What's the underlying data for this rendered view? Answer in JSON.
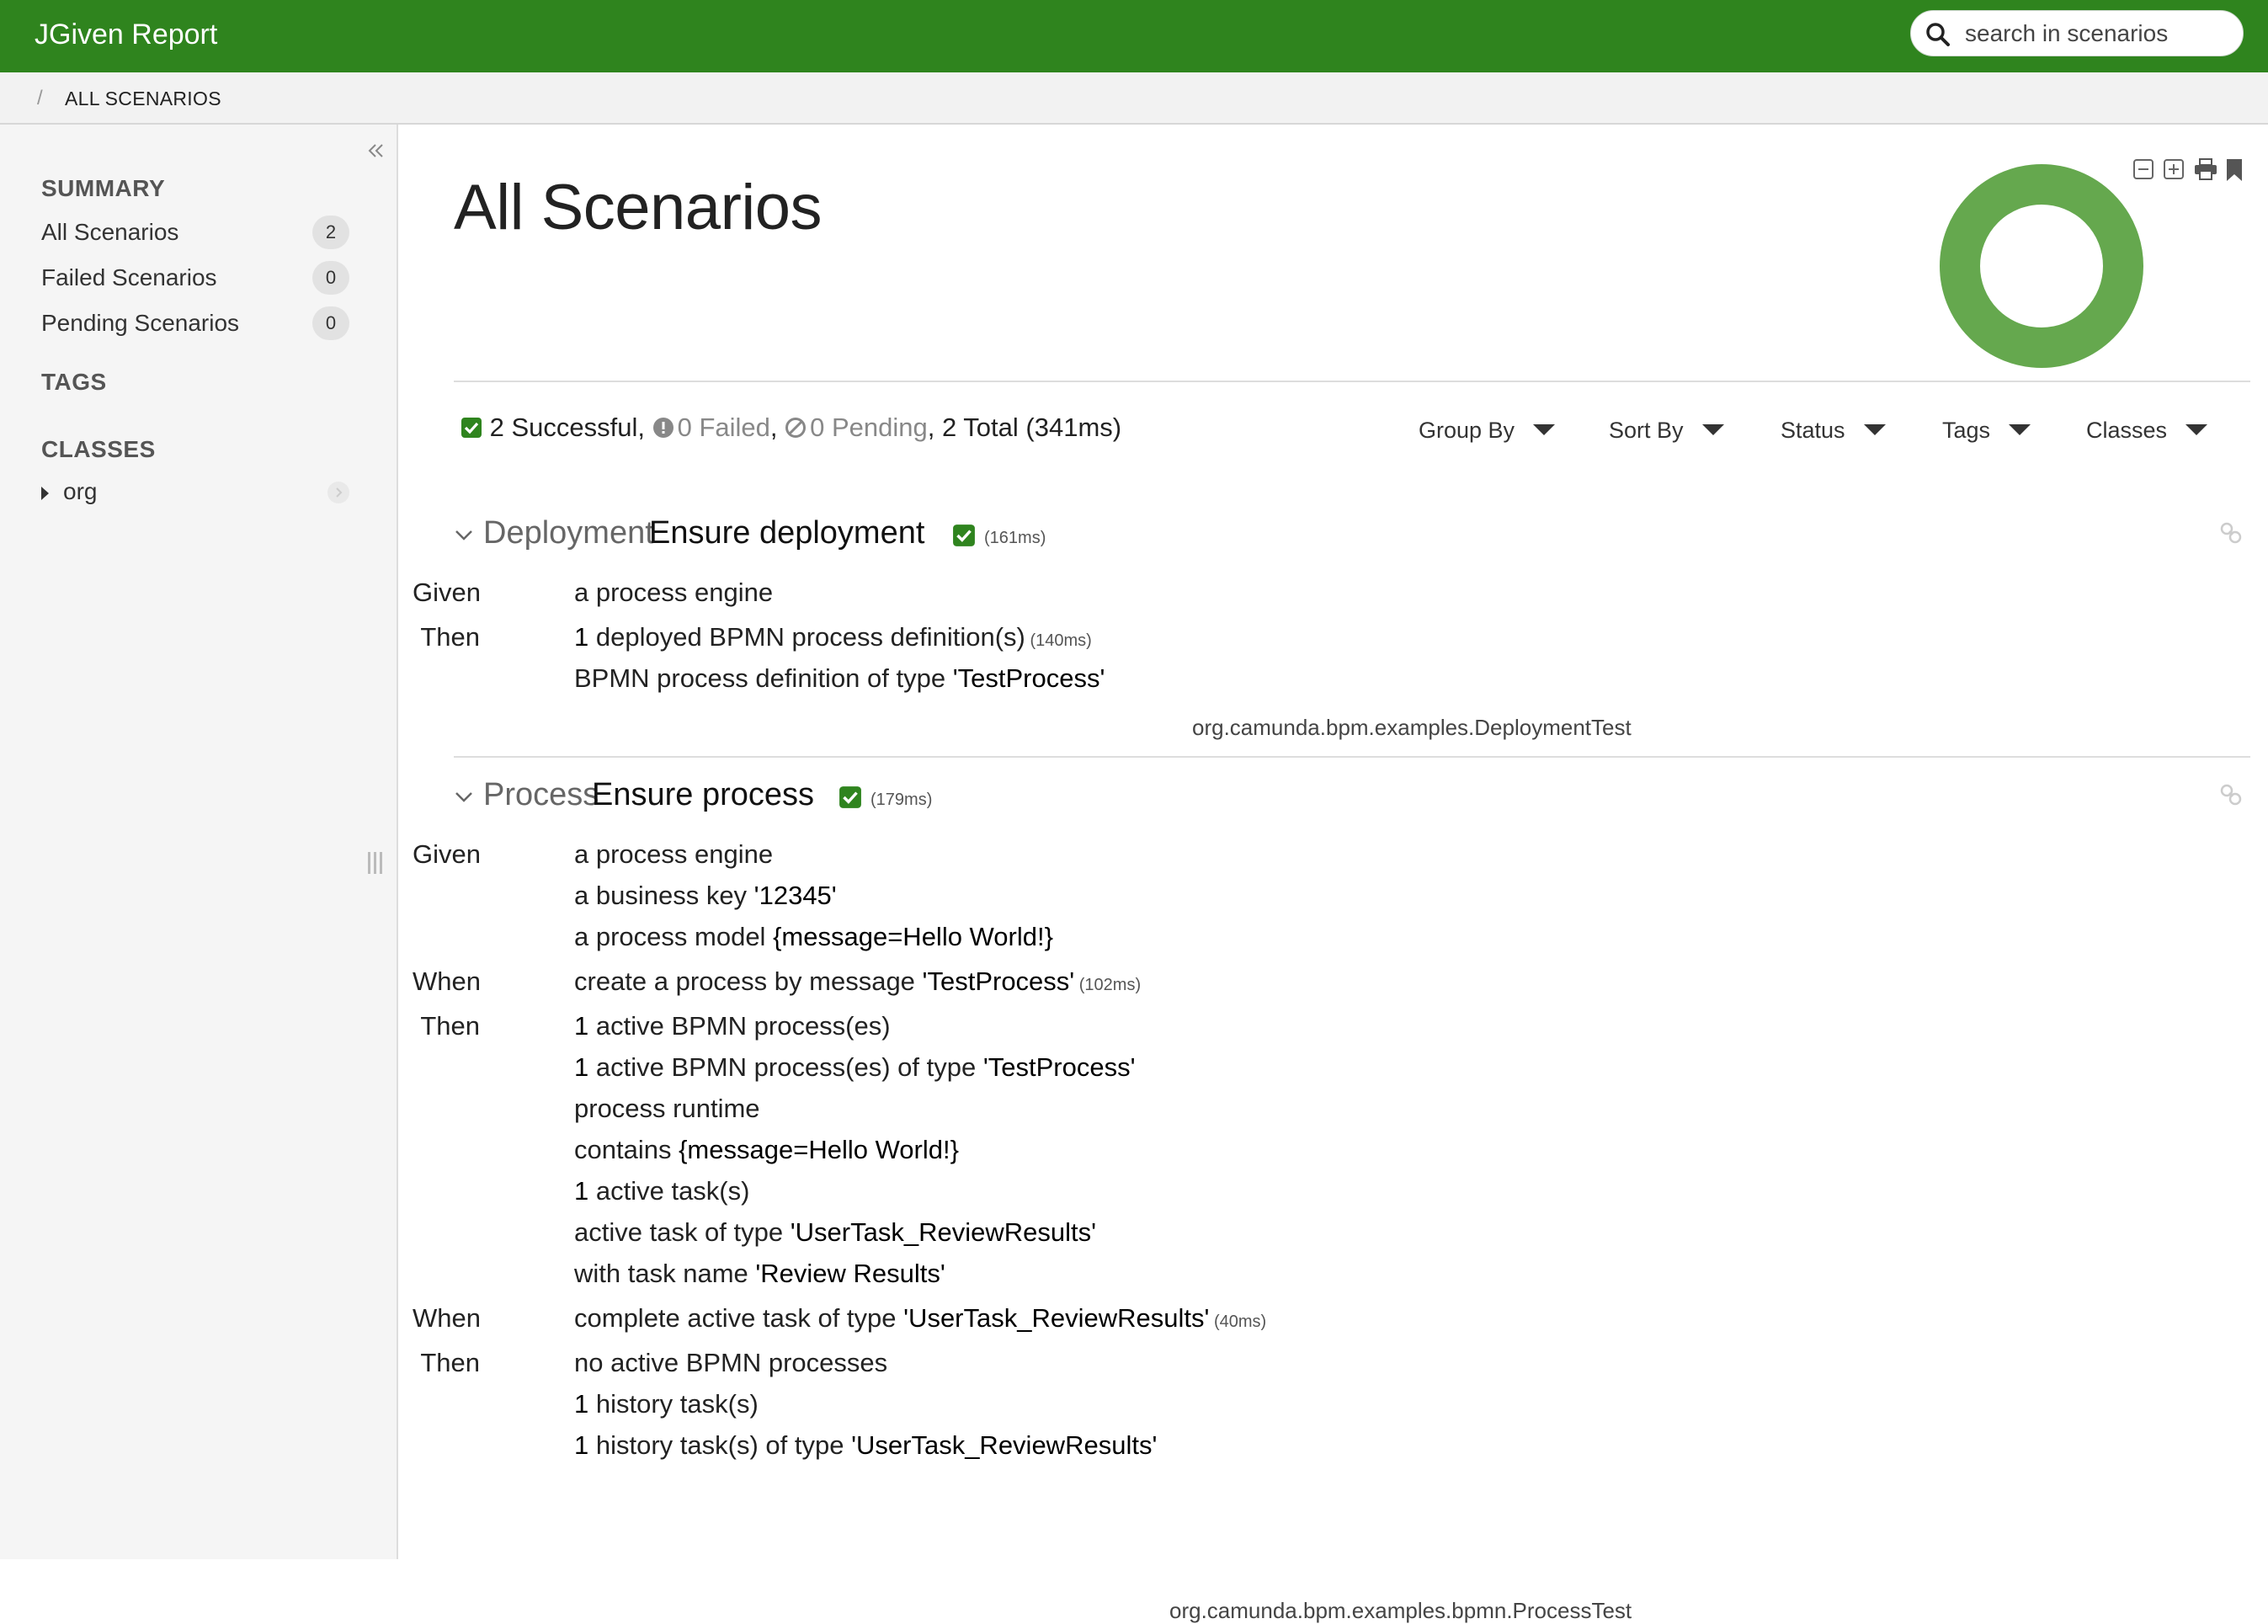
{
  "app": {
    "title": "JGiven Report",
    "accent": "#2f841e",
    "success_color": "#65a84e"
  },
  "search": {
    "placeholder": "search in scenarios"
  },
  "breadcrumb": {
    "items": [
      "ALL SCENARIOS"
    ]
  },
  "sidebar": {
    "summary_title": "SUMMARY",
    "summary_items": [
      {
        "label": "All Scenarios",
        "count": "2"
      },
      {
        "label": "Failed Scenarios",
        "count": "0"
      },
      {
        "label": "Pending Scenarios",
        "count": "0"
      }
    ],
    "tags_title": "TAGS",
    "classes_title": "CLASSES",
    "class_tree": [
      {
        "label": "org"
      }
    ]
  },
  "main": {
    "title": "All Scenarios",
    "status_chart": {
      "successful": 2,
      "failed": 0,
      "pending": 0
    },
    "stats": {
      "successful": "2 Successful",
      "failed": "0 Failed",
      "pending": "0 Pending",
      "total": "2 Total (341ms)"
    },
    "filters": [
      "Group By",
      "Sort By",
      "Status",
      "Tags",
      "Classes"
    ],
    "scenarios": [
      {
        "class_label": "Deployment",
        "name": "Ensure deployment",
        "duration": "(161ms)",
        "steps": [
          {
            "keyword": "Given",
            "parts": [
              {
                "t": "a process engine"
              }
            ],
            "duration": ""
          },
          {
            "keyword": "Then",
            "parts": [
              {
                "t": "1",
                "arg": true
              },
              {
                "t": " deployed BPMN process definition(s)"
              }
            ],
            "duration": "(140ms)"
          },
          {
            "keyword": "",
            "parts": [
              {
                "t": "BPMN process definition of type "
              },
              {
                "t": "'TestProcess'",
                "arg": true
              }
            ],
            "duration": ""
          }
        ],
        "class_name": "org.camunda.bpm.examples.DeploymentTest"
      },
      {
        "class_label": "Process",
        "name": "Ensure process",
        "duration": "(179ms)",
        "steps": [
          {
            "keyword": "Given",
            "parts": [
              {
                "t": "a process engine"
              }
            ],
            "duration": ""
          },
          {
            "keyword": "",
            "parts": [
              {
                "t": "a business key "
              },
              {
                "t": "'12345'",
                "arg": true
              }
            ],
            "duration": ""
          },
          {
            "keyword": "",
            "parts": [
              {
                "t": "a process model "
              },
              {
                "t": "{message=Hello World!}",
                "arg": true
              }
            ],
            "duration": ""
          },
          {
            "keyword": "When",
            "parts": [
              {
                "t": "create a process by message "
              },
              {
                "t": "'TestProcess'",
                "arg": true
              }
            ],
            "duration": "(102ms)"
          },
          {
            "keyword": "Then",
            "parts": [
              {
                "t": "1",
                "arg": true
              },
              {
                "t": " active BPMN process(es)"
              }
            ],
            "duration": ""
          },
          {
            "keyword": "",
            "parts": [
              {
                "t": "1",
                "arg": true
              },
              {
                "t": " active BPMN process(es) of type "
              },
              {
                "t": "'TestProcess'",
                "arg": true
              }
            ],
            "duration": ""
          },
          {
            "keyword": "",
            "parts": [
              {
                "t": "process runtime"
              }
            ],
            "duration": ""
          },
          {
            "keyword": "",
            "parts": [
              {
                "t": "contains "
              },
              {
                "t": "{message=Hello World!}",
                "arg": true
              }
            ],
            "duration": ""
          },
          {
            "keyword": "",
            "parts": [
              {
                "t": "1",
                "arg": true
              },
              {
                "t": " active task(s)"
              }
            ],
            "duration": ""
          },
          {
            "keyword": "",
            "parts": [
              {
                "t": "active task of type "
              },
              {
                "t": "'UserTask_ReviewResults'",
                "arg": true
              }
            ],
            "duration": ""
          },
          {
            "keyword": "",
            "parts": [
              {
                "t": "with task name "
              },
              {
                "t": "'Review Results'",
                "arg": true
              }
            ],
            "duration": ""
          },
          {
            "keyword": "When",
            "parts": [
              {
                "t": "complete active task of type "
              },
              {
                "t": "'UserTask_ReviewResults'",
                "arg": true
              }
            ],
            "duration": "(40ms)"
          },
          {
            "keyword": "Then",
            "parts": [
              {
                "t": "no active BPMN processes"
              }
            ],
            "duration": ""
          },
          {
            "keyword": "",
            "parts": [
              {
                "t": "1",
                "arg": true
              },
              {
                "t": " history task(s)"
              }
            ],
            "duration": ""
          },
          {
            "keyword": "",
            "parts": [
              {
                "t": "1",
                "arg": true
              },
              {
                "t": " history task(s) of type "
              },
              {
                "t": "'UserTask_ReviewResults'",
                "arg": true
              }
            ],
            "duration": ""
          }
        ],
        "class_name": "org.camunda.bpm.examples.bpmn.ProcessTest"
      }
    ]
  }
}
